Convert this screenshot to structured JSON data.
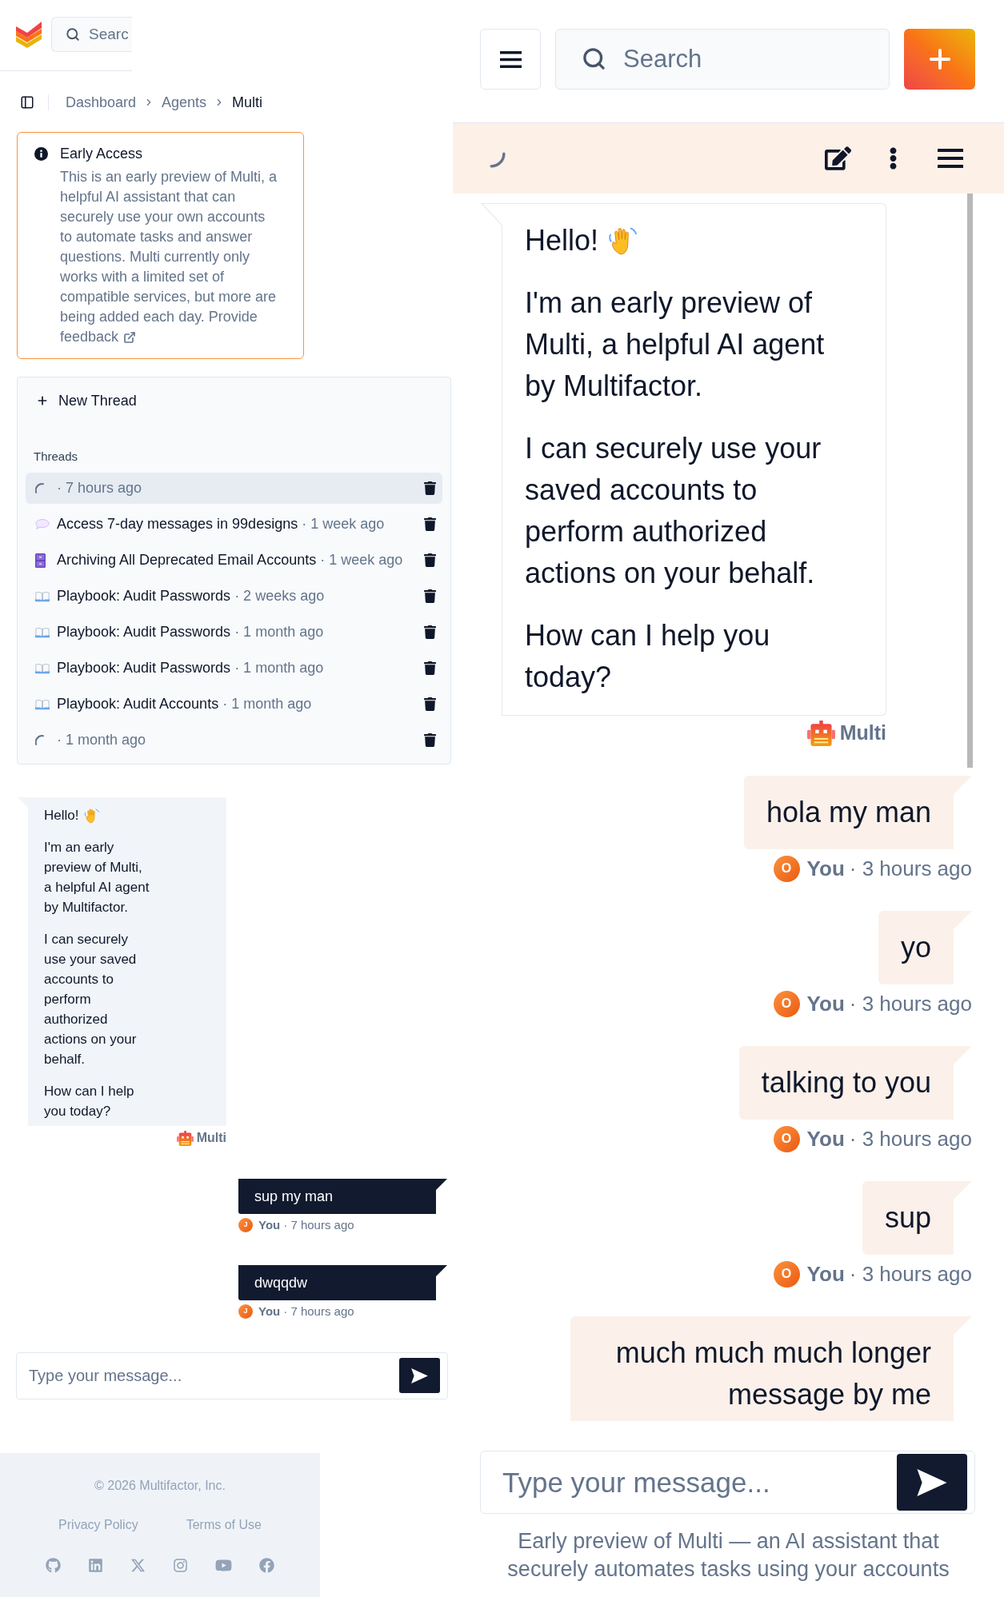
{
  "left_panel": {
    "search": {
      "placeholder": "Searc"
    },
    "breadcrumb": [
      {
        "label": "Dashboard",
        "current": false
      },
      {
        "label": "Agents",
        "current": false
      },
      {
        "label": "Multi",
        "current": true
      }
    ],
    "notice": {
      "title": "Early Access",
      "body": "This is an early preview of Multi, a helpful AI assistant that can securely use your own accounts to automate tasks and answer questions. Multi currently only works with a limited set of compatible services, but more are being added each day. Provide",
      "link": "feedback"
    },
    "threads": {
      "new_thread": "New Thread",
      "heading": "Threads",
      "items": [
        {
          "kind": "pending",
          "time": "· 7 hours ago",
          "selected": true
        },
        {
          "kind": "chat",
          "title": "Access 7-day messages in 99designs",
          "time": "· 1 week ago",
          "selected": false
        },
        {
          "kind": "archive",
          "title": "Archiving All Deprecated Email Accounts",
          "time": "· 1 week ago",
          "selected": false
        },
        {
          "kind": "playbook",
          "title": "Playbook: Audit Passwords",
          "time": "· 2 weeks ago",
          "selected": false
        },
        {
          "kind": "playbook",
          "title": "Playbook: Audit Passwords",
          "time": "· 1 month ago",
          "selected": false
        },
        {
          "kind": "playbook",
          "title": "Playbook: Audit Passwords",
          "time": "· 1 month ago",
          "selected": false
        },
        {
          "kind": "playbook",
          "title": "Playbook: Audit Accounts",
          "time": "· 1 month ago",
          "selected": false
        },
        {
          "kind": "pending",
          "time": "· 1 month ago",
          "selected": false
        }
      ]
    },
    "chat": {
      "messages": [
        {
          "kind": "assistant",
          "greeting": "Hello!",
          "paragraphs": [
            "I'm an early preview of Multi, a helpful AI agent by Multifactor.",
            "I can securely use your saved accounts to perform authorized actions on your behalf.",
            "How can I help you today?"
          ],
          "author": "Multi"
        },
        {
          "kind": "user",
          "text": "sup my man",
          "avatar": "J",
          "author": "You",
          "time": "· 7 hours ago"
        },
        {
          "kind": "user",
          "text": "dwqqdw",
          "avatar": "J",
          "author": "You",
          "time": "· 7 hours ago"
        }
      ],
      "input": {
        "placeholder": "Type your message..."
      }
    },
    "footer": {
      "copyright": "© 2026 Multifactor, Inc.",
      "links": [
        "Privacy Policy",
        "Terms of Use"
      ]
    }
  },
  "right_panel": {
    "search": {
      "placeholder": "Search"
    },
    "chat": {
      "messages": [
        {
          "kind": "assistant",
          "greeting": "Hello!",
          "paragraphs": [
            "I'm an early preview of Multi, a helpful AI agent by Multifactor.",
            "I can securely use your saved accounts to perform authorized actions on your behalf.",
            "How can I help you today?"
          ],
          "author": "Multi"
        },
        {
          "kind": "user",
          "text": "hola my man",
          "avatar": "O",
          "author": "You",
          "time": "· 3 hours ago"
        },
        {
          "kind": "user",
          "text": "yo",
          "avatar": "O",
          "author": "You",
          "time": "· 3 hours ago"
        },
        {
          "kind": "user",
          "text": "talking to you",
          "avatar": "O",
          "author": "You",
          "time": "· 3 hours ago"
        },
        {
          "kind": "user",
          "text": "sup",
          "avatar": "O",
          "author": "You",
          "time": "· 3 hours ago"
        },
        {
          "kind": "user",
          "text": "much much much longer message by me"
        }
      ],
      "input": {
        "placeholder": "Type your message..."
      }
    },
    "caption": "Early preview of Multi — an AI assistant that securely automates tasks using your accounts"
  }
}
